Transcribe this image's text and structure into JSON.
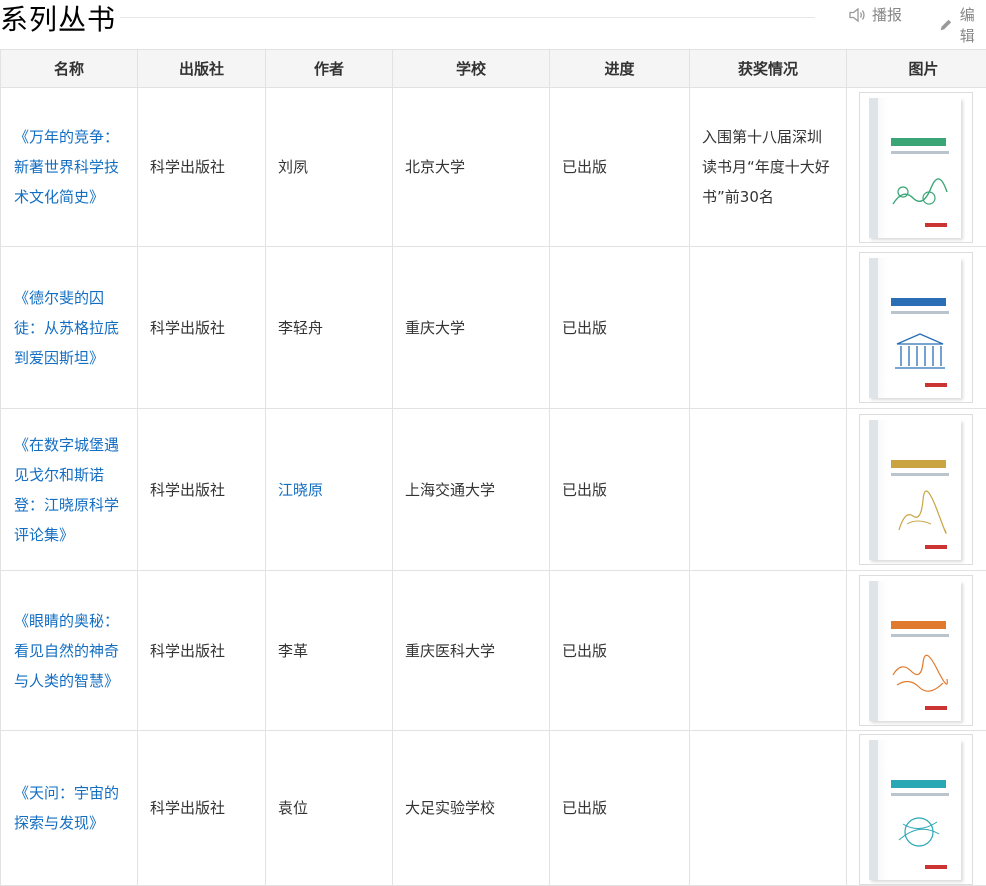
{
  "header": {
    "title": "系列丛书",
    "play_label": "播报",
    "edit_label": "编辑"
  },
  "table": {
    "columns": [
      "名称",
      "出版社",
      "作者",
      "学校",
      "进度",
      "获奖情况",
      "图片"
    ],
    "rows": [
      {
        "name": "《万年的竞争：新著世界科学技术文化简史》",
        "publisher": "科学出版社",
        "author": "刘夙",
        "school": "北京大学",
        "progress": "已出版",
        "award": "入围第十八届深圳读书月“年度十大好书”前30名",
        "image": "book-cover"
      },
      {
        "name": "《德尔斐的囚徒：从苏格拉底到爱因斯坦》",
        "publisher": "科学出版社",
        "author": "李轻舟",
        "school": "重庆大学",
        "progress": "已出版",
        "award": "",
        "image": "book-cover"
      },
      {
        "name": "《在数字城堡遇见戈尔和斯诺登：江晓原科学评论集》",
        "publisher": "科学出版社",
        "author": "江晓原",
        "school": "上海交通大学",
        "progress": "已出版",
        "award": "",
        "image": "book-cover"
      },
      {
        "name": "《眼睛的奥秘：看见自然的神奇与人类的智慧》",
        "publisher": "科学出版社",
        "author": "李革",
        "school": "重庆医科大学",
        "progress": "已出版",
        "award": "",
        "image": "book-cover"
      },
      {
        "name": "《天问：宇宙的探索与发现》",
        "publisher": "科学出版社",
        "author": "袁位",
        "school": "大足实验学校",
        "progress": "已出版",
        "award": "",
        "image": "book-cover"
      }
    ]
  },
  "colors": {
    "link": "#136ec2",
    "header_bg": "#f5f5f5",
    "border": "#e2e2e2",
    "cover_accents": [
      "#3aa676",
      "#2a6fb5",
      "#c9a441",
      "#e07a2e",
      "#2aa7b5"
    ]
  }
}
